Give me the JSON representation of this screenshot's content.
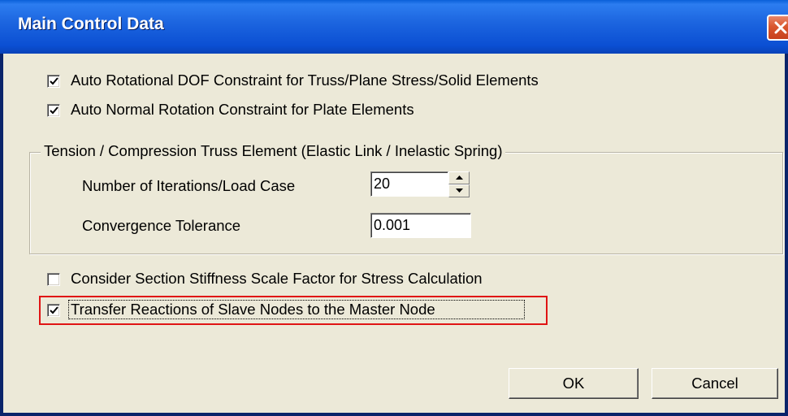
{
  "window": {
    "title": "Main Control Data",
    "close_icon": "close-icon"
  },
  "options": {
    "auto_rotational": {
      "label": "Auto Rotational DOF Constraint for Truss/Plane Stress/Solid Elements",
      "checked": true
    },
    "auto_normal": {
      "label": "Auto Normal Rotation Constraint for Plate Elements",
      "checked": true
    },
    "section_stiffness": {
      "label": "Consider Section Stiffness Scale Factor for Stress Calculation",
      "checked": false
    },
    "transfer_reactions": {
      "label": "Transfer Reactions of Slave Nodes to the Master Node",
      "checked": true
    }
  },
  "group": {
    "legend": "Tension / Compression Truss Element (Elastic Link / Inelastic Spring)",
    "iterations_label": "Number of Iterations/Load Case",
    "iterations_value": "20",
    "tolerance_label": "Convergence Tolerance",
    "tolerance_value": "0.001"
  },
  "buttons": {
    "ok": "OK",
    "cancel": "Cancel"
  },
  "colors": {
    "highlight": "#e01414",
    "titlebar": "#0b4fd3",
    "dialog_bg": "#ece9d8"
  }
}
